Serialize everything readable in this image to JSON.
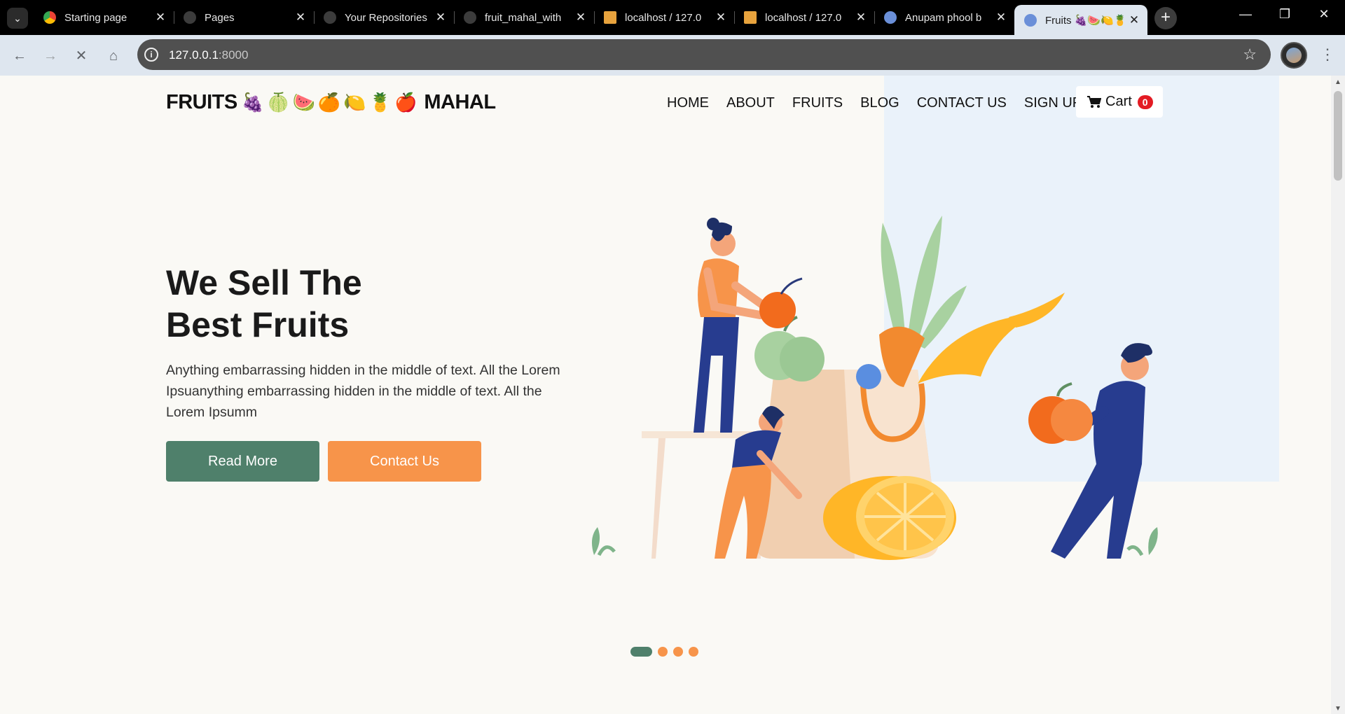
{
  "browser": {
    "tabs": [
      {
        "title": "Starting page",
        "fav": "#4285f4"
      },
      {
        "title": "Pages",
        "fav": "#3c3c3c"
      },
      {
        "title": "Your Repositories",
        "fav": "#3c3c3c"
      },
      {
        "title": "fruit_mahal_with",
        "fav": "#3c3c3c"
      },
      {
        "title": "localhost / 127.0",
        "fav": "#e8a33d"
      },
      {
        "title": "localhost / 127.0",
        "fav": "#e8a33d"
      },
      {
        "title": "Anupam phool b",
        "fav": "#6a8fd8"
      },
      {
        "title": "Fruits 🍇🍉🍋🍍",
        "fav": "#6a8fd8"
      }
    ],
    "close_glyph": "✕",
    "new_tab_glyph": "+",
    "url_host": "127.0.0.1",
    "url_port": ":8000"
  },
  "site": {
    "brand_left": "FRUITS",
    "brand_fruits": "🍇🍈🍉🍊🍋🍍🍎",
    "brand_right": "MAHAL",
    "nav": [
      "HOME",
      "ABOUT",
      "FRUITS",
      "BLOG",
      "CONTACT US",
      "SIGN UP"
    ],
    "cart_label": "Cart",
    "cart_count": "0"
  },
  "hero": {
    "title_line1": "We Sell The",
    "title_line2": "Best Fruits",
    "text": "Anything embarrassing hidden in the middle of text. All the Lorem Ipsuanything embarrassing hidden in the middle of text. All the Lorem Ipsumm",
    "read_more": "Read More",
    "contact_us": "Contact Us"
  },
  "carousel": {
    "slides": 4,
    "active": 1
  },
  "colors": {
    "primary_green": "#4f806b",
    "accent_orange": "#f7944a",
    "badge_red": "#e31b23"
  }
}
